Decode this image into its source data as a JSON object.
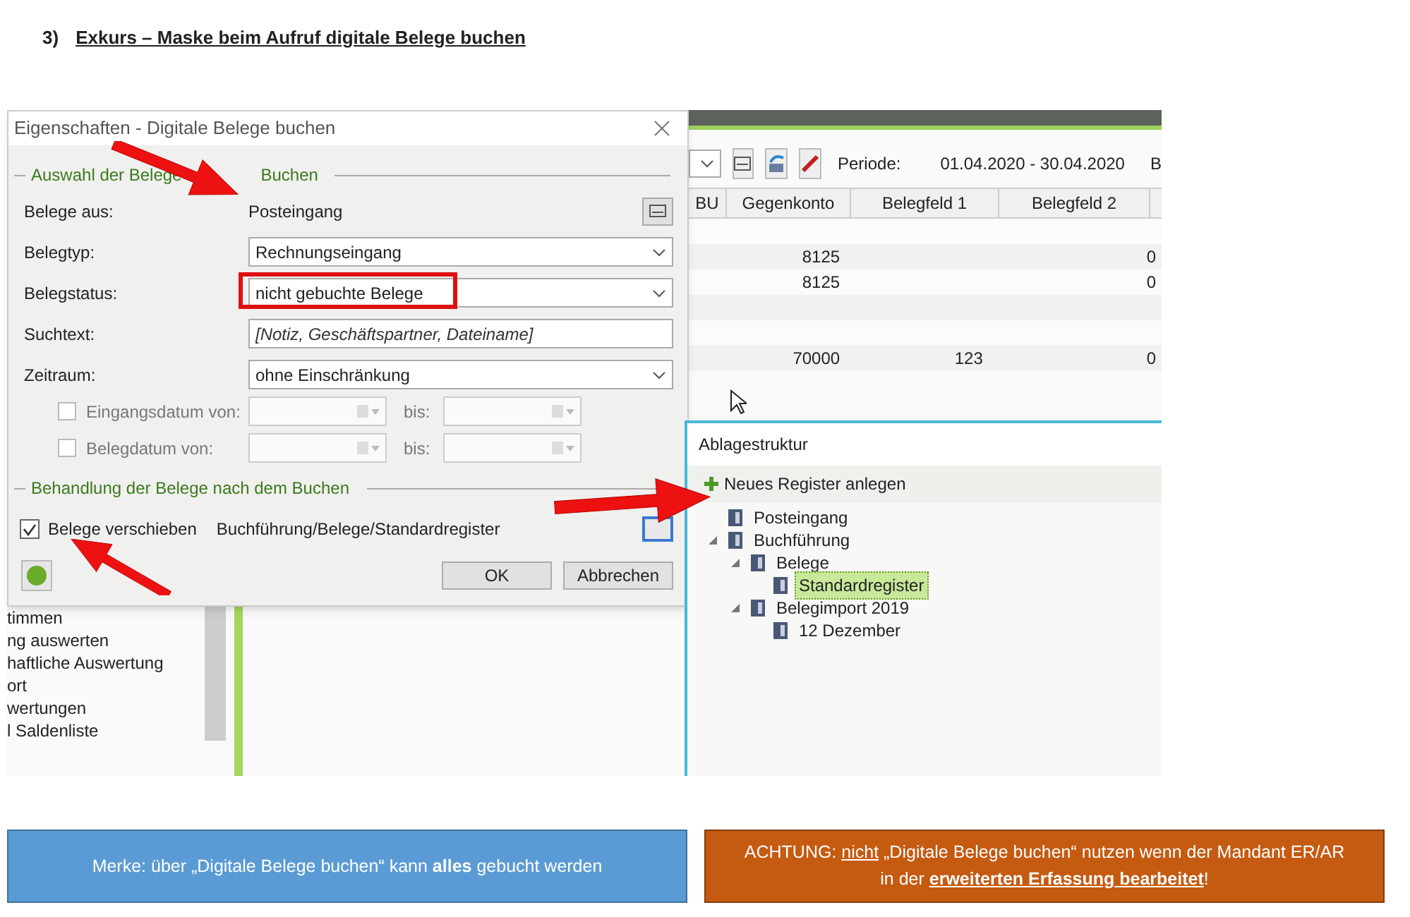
{
  "heading": {
    "number": "3)",
    "title": "Exkurs – Maske beim Aufruf digitale Belege buchen"
  },
  "dialog": {
    "title": "Eigenschaften - Digitale Belege buchen",
    "group1": [
      "Auswahl der Belege",
      "Buchen"
    ],
    "rows": [
      {
        "kind": "static",
        "label": "Belege aus:",
        "value": "Posteingang"
      },
      {
        "kind": "combo",
        "label": "Belegtyp:",
        "value": "Rechnungseingang",
        "highlighted": false
      },
      {
        "kind": "combo",
        "label": "Belegstatus:",
        "value": "nicht gebuchte Belege",
        "highlighted": true
      },
      {
        "kind": "text",
        "label": "Suchtext:",
        "placeholder": "[Notiz, Geschäftspartner, Dateiname]"
      },
      {
        "kind": "combo",
        "label": "Zeitraum:",
        "value": "ohne Einschränkung",
        "highlighted": false
      }
    ],
    "dates": [
      {
        "label": "Eingangsdatum von:",
        "checked": false,
        "to": "bis:"
      },
      {
        "label": "Belegdatum von:",
        "checked": false,
        "to": "bis:"
      }
    ],
    "group2": "Behandlung der Belege nach dem Buchen",
    "move": {
      "label": "Belege verschieben",
      "checked": true,
      "path": "Buchführung/Belege/Standardregister"
    },
    "buttons": [
      "OK",
      "Abbrechen"
    ]
  },
  "app": {
    "period_label": "Periode:",
    "period": "01.04.2020 - 30.04.2020",
    "cut_label": "B",
    "columns": [
      "BU",
      "Gegenkonto",
      "Belegfeld 1",
      "Belegfeld 2"
    ],
    "rows": [
      [
        "",
        "",
        "",
        "",
        ""
      ],
      [
        "",
        "8125",
        "",
        "",
        "0"
      ],
      [
        "",
        "8125",
        "",
        "",
        "0"
      ],
      [
        "",
        "",
        "",
        "",
        ""
      ],
      [
        "",
        "",
        "",
        "",
        ""
      ],
      [
        "",
        "70000",
        "123",
        "",
        "0"
      ]
    ],
    "nav_items": [
      "timmen",
      "ng auswerten",
      "haftliche Auswertung",
      "ort",
      "wertungen",
      "l Saldenliste"
    ]
  },
  "ablage": {
    "title": "Ablagestruktur",
    "action": "Neues Register anlegen",
    "tree": [
      {
        "label": "Posteingang",
        "selected": false
      },
      {
        "label": "Buchführung",
        "selected": false,
        "expanded": true,
        "children": [
          {
            "label": "Belege",
            "selected": false,
            "expanded": true,
            "children": [
              {
                "label": "Standardregister",
                "selected": true
              }
            ]
          },
          {
            "label": "Belegimport 2019",
            "selected": false,
            "expanded": true,
            "children": [
              {
                "label": "12 Dezember",
                "selected": false
              }
            ]
          }
        ]
      }
    ]
  },
  "notes": [
    {
      "kind": "info",
      "lines": [
        [
          {
            "kind": "rich",
            "text": "Merke: über „Digitale Belege buchen“ kann **alles** gebucht werden"
          }
        ]
      ]
    },
    {
      "kind": "warning",
      "lines": [
        [
          {
            "kind": "plain",
            "text": "ACHTUNG: "
          },
          {
            "kind": "underline",
            "text": "nicht"
          },
          {
            "kind": "plain",
            "text": " „Digitale Belege buchen“ nutzen wenn der Mandant ER/AR"
          }
        ],
        [
          {
            "kind": "plain",
            "text": "in der "
          },
          {
            "kind": "bold_underline",
            "text": "erweiterten Erfassung bearbeitet"
          },
          {
            "kind": "plain",
            "text": "!"
          }
        ]
      ]
    }
  ]
}
